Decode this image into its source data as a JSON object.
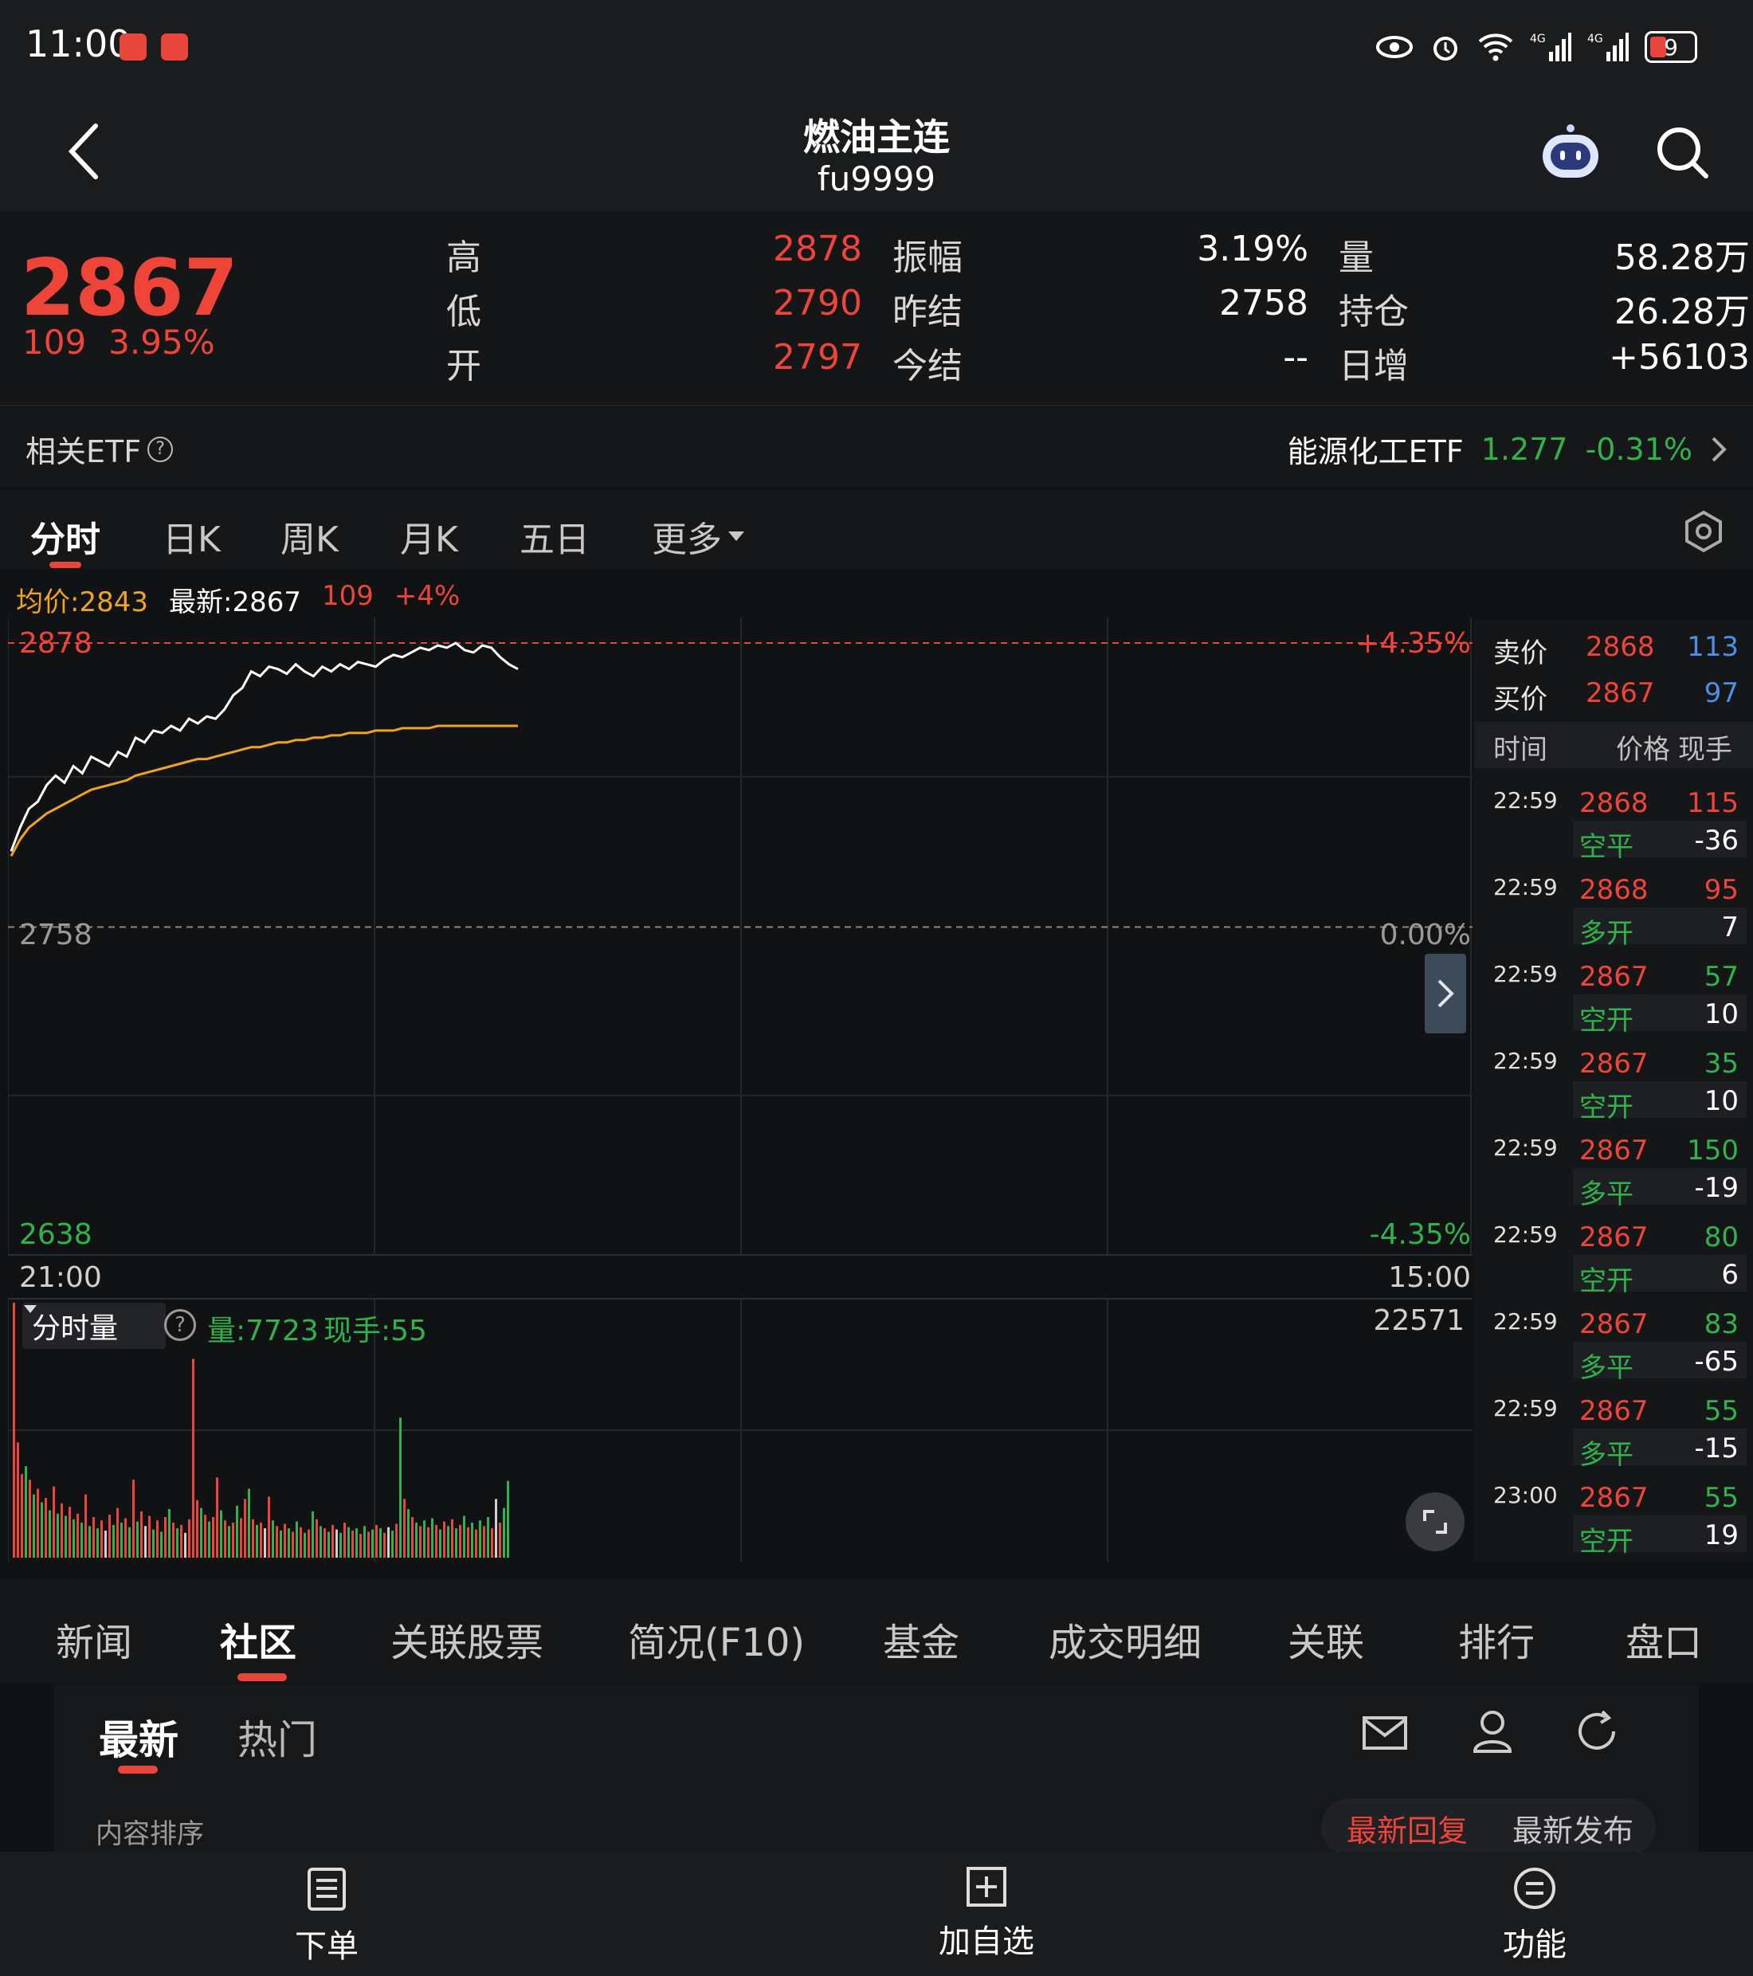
{
  "status_bar": {
    "time": "11:00",
    "battery": "9"
  },
  "header": {
    "title": "燃油主连",
    "code": "fu9999"
  },
  "quote": {
    "last": "2867",
    "change": "109",
    "change_pct": "3.95%",
    "high_label": "高",
    "high": "2878",
    "low_label": "低",
    "low": "2790",
    "open_label": "开",
    "open": "2797",
    "amp_label": "振幅",
    "amp": "3.19%",
    "prev_settle_label": "昨结",
    "prev_settle": "2758",
    "settle_label": "今结",
    "settle": "--",
    "vol_label": "量",
    "vol": "58.28万",
    "oi_label": "持仓",
    "oi": "26.28万",
    "daily_inc_label": "日增",
    "daily_inc": "+56103"
  },
  "etf": {
    "label": "相关ETF",
    "name": "能源化工ETF",
    "price": "1.277",
    "change": "-0.31%"
  },
  "period_tabs": [
    "分时",
    "日K",
    "周K",
    "月K",
    "五日",
    "更多"
  ],
  "chart_info": {
    "avg": "均价:2843",
    "latest": "最新:2867",
    "chg": "109",
    "pct": "+4%"
  },
  "chart_labels": {
    "y_top": "2878",
    "y_mid": "2758",
    "y_bot": "2638",
    "pct_top": "+4.35%",
    "pct_mid": "0.00%",
    "pct_bot": "-4.35%",
    "t_start": "21:00",
    "t_end": "15:00",
    "vol_selector": "分时量",
    "vol_info": "量:7723",
    "vol_hand": "现手:55",
    "vol_max": "22571"
  },
  "order_book": {
    "ask_label": "卖价",
    "ask_price": "2868",
    "ask_vol": "113",
    "bid_label": "买价",
    "bid_price": "2867",
    "bid_vol": "97",
    "col_time": "时间",
    "col_price": "价格",
    "col_hand": "现手"
  },
  "trades": [
    {
      "time": "22:59",
      "price": "2868",
      "hand": "115",
      "type": "空平",
      "delta": "-36"
    },
    {
      "time": "22:59",
      "price": "2868",
      "hand": "95",
      "type": "多开",
      "delta": "7"
    },
    {
      "time": "22:59",
      "price": "2867",
      "hand": "57",
      "type": "空开",
      "delta": "10"
    },
    {
      "time": "22:59",
      "price": "2867",
      "hand": "35",
      "type": "空开",
      "delta": "10"
    },
    {
      "time": "22:59",
      "price": "2867",
      "hand": "150",
      "type": "多平",
      "delta": "-19"
    },
    {
      "time": "22:59",
      "price": "2867",
      "hand": "80",
      "type": "空开",
      "delta": "6"
    },
    {
      "time": "22:59",
      "price": "2867",
      "hand": "83",
      "type": "多平",
      "delta": "-65"
    },
    {
      "time": "22:59",
      "price": "2867",
      "hand": "55",
      "type": "多平",
      "delta": "-15"
    },
    {
      "time": "23:00",
      "price": "2867",
      "hand": "55",
      "type": "空开",
      "delta": "19"
    }
  ],
  "bottom_tabs": [
    "新闻",
    "社区",
    "关联股票",
    "简况(F10)",
    "基金",
    "成交明细",
    "关联",
    "排行",
    "盘口"
  ],
  "community": {
    "tab_latest": "最新",
    "tab_hot": "热门",
    "sort_label": "内容排序",
    "sort_a": "最新回复",
    "sort_b": "最新发布"
  },
  "footer": {
    "order": "下单",
    "watch": "加自选",
    "func": "功能"
  },
  "chart_data": {
    "type": "line",
    "prev_settle": 2758,
    "ylim": [
      2638,
      2878
    ],
    "pct_range": [
      -4.35,
      4.35
    ],
    "session": [
      "21:00",
      "15:00"
    ],
    "series": [
      {
        "values": [
          2790,
          2800,
          2808,
          2811,
          2818,
          2822,
          2819,
          2826,
          2823,
          2830,
          2828,
          2826,
          2832,
          2830,
          2838,
          2836,
          2841,
          2840,
          2843,
          2841,
          2846,
          2844,
          2847,
          2846,
          2850,
          2856,
          2859,
          2866,
          2864,
          2868,
          2867,
          2865,
          2869,
          2866,
          2864,
          2868,
          2866,
          2869,
          2867,
          2870,
          2869,
          2868,
          2871,
          2873,
          2872,
          2874,
          2876,
          2875,
          2877,
          2876,
          2878,
          2875,
          2874,
          2877,
          2876,
          2872,
          2869,
          2867
        ]
      },
      {
        "values": [
          2788,
          2795,
          2800,
          2803,
          2806,
          2808,
          2810,
          2812,
          2814,
          2816,
          2817,
          2818,
          2819,
          2820,
          2822,
          2823,
          2824,
          2825,
          2826,
          2827,
          2828,
          2829,
          2829,
          2830,
          2831,
          2832,
          2833,
          2834,
          2834,
          2835,
          2836,
          2836,
          2837,
          2837,
          2838,
          2838,
          2839,
          2839,
          2840,
          2840,
          2840,
          2841,
          2841,
          2841,
          2842,
          2842,
          2842,
          2842,
          2843,
          2843,
          2843,
          2843,
          2843,
          2843,
          2843,
          2843,
          2843,
          2843
        ]
      }
    ],
    "volume_max": 22571,
    "volume": [
      {
        "v": 22571,
        "c": "r"
      },
      {
        "v": 10200,
        "c": "r"
      },
      {
        "v": 7400,
        "c": "r"
      },
      {
        "v": 8100,
        "c": "g"
      },
      {
        "v": 6900,
        "c": "r"
      },
      {
        "v": 5600,
        "c": "g"
      },
      {
        "v": 6100,
        "c": "r"
      },
      {
        "v": 4900,
        "c": "g"
      },
      {
        "v": 5300,
        "c": "r"
      },
      {
        "v": 4200,
        "c": "g"
      },
      {
        "v": 6300,
        "c": "r"
      },
      {
        "v": 3900,
        "c": "g"
      },
      {
        "v": 4800,
        "c": "r"
      },
      {
        "v": 3700,
        "c": "g"
      },
      {
        "v": 4500,
        "c": "r"
      },
      {
        "v": 3400,
        "c": "g"
      },
      {
        "v": 3900,
        "c": "r"
      },
      {
        "v": 3100,
        "c": "g"
      },
      {
        "v": 5600,
        "c": "r"
      },
      {
        "v": 2800,
        "c": "g"
      },
      {
        "v": 3600,
        "c": "r"
      },
      {
        "v": 2600,
        "c": "g"
      },
      {
        "v": 3300,
        "c": "r"
      },
      {
        "v": 2400,
        "c": "w"
      },
      {
        "v": 3800,
        "c": "r"
      },
      {
        "v": 2900,
        "c": "g"
      },
      {
        "v": 4400,
        "c": "r"
      },
      {
        "v": 3100,
        "c": "g"
      },
      {
        "v": 3500,
        "c": "r"
      },
      {
        "v": 2700,
        "c": "g"
      },
      {
        "v": 6900,
        "c": "r"
      },
      {
        "v": 3200,
        "c": "g"
      },
      {
        "v": 4100,
        "c": "r"
      },
      {
        "v": 2800,
        "c": "w"
      },
      {
        "v": 3700,
        "c": "r"
      },
      {
        "v": 2500,
        "c": "g"
      },
      {
        "v": 3300,
        "c": "r"
      },
      {
        "v": 2300,
        "c": "g"
      },
      {
        "v": 3600,
        "c": "r"
      },
      {
        "v": 4300,
        "c": "g"
      },
      {
        "v": 3100,
        "c": "r"
      },
      {
        "v": 2600,
        "c": "g"
      },
      {
        "v": 2900,
        "c": "r"
      },
      {
        "v": 2200,
        "c": "w"
      },
      {
        "v": 3400,
        "c": "r"
      },
      {
        "v": 17600,
        "c": "r"
      },
      {
        "v": 5100,
        "c": "r"
      },
      {
        "v": 4400,
        "c": "g"
      },
      {
        "v": 3800,
        "c": "r"
      },
      {
        "v": 3200,
        "c": "g"
      },
      {
        "v": 3600,
        "c": "r"
      },
      {
        "v": 7100,
        "c": "r"
      },
      {
        "v": 4200,
        "c": "g"
      },
      {
        "v": 3300,
        "c": "r"
      },
      {
        "v": 2800,
        "c": "g"
      },
      {
        "v": 3100,
        "c": "r"
      },
      {
        "v": 4600,
        "c": "g"
      },
      {
        "v": 3500,
        "c": "r"
      },
      {
        "v": 5200,
        "c": "r"
      },
      {
        "v": 6100,
        "c": "g"
      },
      {
        "v": 3400,
        "c": "r"
      },
      {
        "v": 2900,
        "c": "g"
      },
      {
        "v": 3100,
        "c": "r"
      },
      {
        "v": 2600,
        "c": "w"
      },
      {
        "v": 5400,
        "c": "r"
      },
      {
        "v": 3300,
        "c": "g"
      },
      {
        "v": 2800,
        "c": "r"
      },
      {
        "v": 2400,
        "c": "g"
      },
      {
        "v": 3000,
        "c": "r"
      },
      {
        "v": 2600,
        "c": "g"
      },
      {
        "v": 2300,
        "c": "r"
      },
      {
        "v": 3200,
        "c": "g"
      },
      {
        "v": 2700,
        "c": "r"
      },
      {
        "v": 2200,
        "c": "g"
      },
      {
        "v": 2500,
        "c": "r"
      },
      {
        "v": 4100,
        "c": "g"
      },
      {
        "v": 3400,
        "c": "r"
      },
      {
        "v": 2800,
        "c": "g"
      },
      {
        "v": 2600,
        "c": "r"
      },
      {
        "v": 2300,
        "c": "g"
      },
      {
        "v": 2900,
        "c": "r"
      },
      {
        "v": 2500,
        "c": "w"
      },
      {
        "v": 2200,
        "c": "g"
      },
      {
        "v": 3100,
        "c": "r"
      },
      {
        "v": 2700,
        "c": "g"
      },
      {
        "v": 2400,
        "c": "r"
      },
      {
        "v": 2600,
        "c": "g"
      },
      {
        "v": 2100,
        "c": "r"
      },
      {
        "v": 2800,
        "c": "g"
      },
      {
        "v": 2300,
        "c": "r"
      },
      {
        "v": 2500,
        "c": "g"
      },
      {
        "v": 2900,
        "c": "r"
      },
      {
        "v": 2600,
        "c": "g"
      },
      {
        "v": 2200,
        "c": "r"
      },
      {
        "v": 2700,
        "c": "w"
      },
      {
        "v": 2400,
        "c": "g"
      },
      {
        "v": 3000,
        "c": "r"
      },
      {
        "v": 12400,
        "c": "g"
      },
      {
        "v": 5200,
        "c": "r"
      },
      {
        "v": 4300,
        "c": "g"
      },
      {
        "v": 3600,
        "c": "r"
      },
      {
        "v": 3100,
        "c": "g"
      },
      {
        "v": 2800,
        "c": "r"
      },
      {
        "v": 3300,
        "c": "g"
      },
      {
        "v": 2700,
        "c": "r"
      },
      {
        "v": 3500,
        "c": "g"
      },
      {
        "v": 2900,
        "c": "r"
      },
      {
        "v": 2500,
        "c": "g"
      },
      {
        "v": 3200,
        "c": "r"
      },
      {
        "v": 2800,
        "c": "g"
      },
      {
        "v": 3400,
        "c": "r"
      },
      {
        "v": 2600,
        "c": "g"
      },
      {
        "v": 2900,
        "c": "r"
      },
      {
        "v": 3700,
        "c": "g"
      },
      {
        "v": 2700,
        "c": "r"
      },
      {
        "v": 3100,
        "c": "g"
      },
      {
        "v": 2500,
        "c": "r"
      },
      {
        "v": 3300,
        "c": "g"
      },
      {
        "v": 2800,
        "c": "r"
      },
      {
        "v": 3600,
        "c": "g"
      },
      {
        "v": 2600,
        "c": "r"
      },
      {
        "v": 5200,
        "c": "w"
      },
      {
        "v": 3100,
        "c": "r"
      },
      {
        "v": 4400,
        "c": "g"
      },
      {
        "v": 6800,
        "c": "g"
      }
    ]
  }
}
